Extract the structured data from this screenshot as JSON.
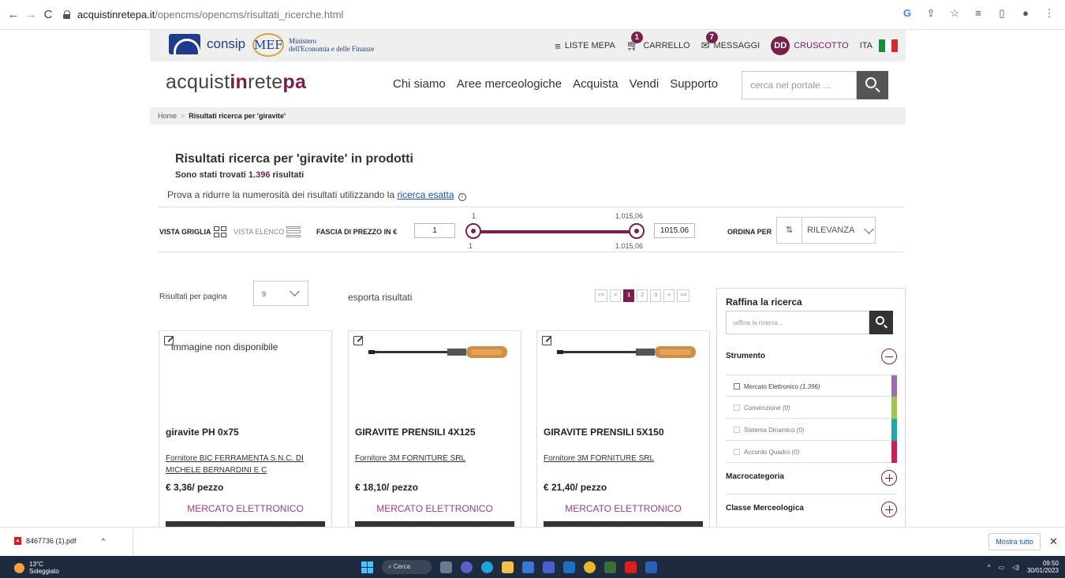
{
  "browser": {
    "url_host": "acquistinretepa.it",
    "url_path": "/opencms/opencms/risultati_ricerche.html"
  },
  "top_bar": {
    "consip_label": "consip",
    "mef_label": "MEF",
    "mef_line1": "Ministero",
    "mef_line2": "dell'Economia e delle Finanze",
    "liste_mepa": "LISTE MEPA",
    "carrello": "CARRELLO",
    "carrello_badge": "1",
    "messaggi": "MESSAGGI",
    "messaggi_badge": "7",
    "avatar": "DD",
    "cruscotto": "CRUSCOTTO",
    "lang": "ITA"
  },
  "header": {
    "brand_a": "acquist",
    "brand_b": "in",
    "brand_c": "rete",
    "brand_d": "pa",
    "nav": [
      "Chi siamo",
      "Aree merceologiche",
      "Acquista",
      "Vendi",
      "Supporto"
    ],
    "search_placeholder": "cerca nel portale ..."
  },
  "breadcrumb": {
    "home": "Home",
    "sep": ">",
    "current": "Risultati ricerca per 'giravite'"
  },
  "results": {
    "title": "Risultati ricerca per 'giravite' in prodotti",
    "count_prefix": "Sono stati trovati ",
    "count": "1.396",
    "count_suffix": " risultati",
    "tip_prefix": "Prova a ridurre la numerosità dei risultati utilizzando la ",
    "tip_link": "ricerca esatta"
  },
  "toolbar": {
    "vista_griglia": "VISTA GRIGLIA",
    "vista_elenco": "VISTA ELENCO",
    "fascia_prezzo": "FASCIA DI PREZZO IN €",
    "price_min": "1",
    "price_max": "1015.06",
    "slider_min_label": "1",
    "slider_max_label": "1.015,06",
    "ordina_per": "ORDINA PER",
    "sort_value": "RILEVANZA"
  },
  "listing": {
    "perpage_label": "Risultati per pagina",
    "perpage_value": "9",
    "export": "esporta risultati",
    "pager": [
      "<<",
      "<",
      "1",
      "2",
      "3",
      ">",
      ">>"
    ],
    "active_page": "1"
  },
  "cards": [
    {
      "img_alt": "immagine non disponibile",
      "title": "giravite PH 0x75",
      "supplier": "Fornitore BIC FERRAMENTA S.N.C. DI MICHELE BERNARDINI E C",
      "price": "€ 3,36/ pezzo",
      "market": "MERCATO ELETTRONICO"
    },
    {
      "img_alt": "",
      "title": "GIRAVITE PRENSILI 4X125",
      "supplier": "Fornitore 3M FORNITURE SRL",
      "price": "€ 18,10/ pezzo",
      "market": "MERCATO ELETTRONICO"
    },
    {
      "img_alt": "",
      "title": "GIRAVITE PRENSILI 5X150",
      "supplier": "Fornitore 3M FORNITURE SRL",
      "price": "€ 21,40/ pezzo",
      "market": "MERCATO ELETTRONICO"
    }
  ],
  "sidebar": {
    "title": "Raffina la ricerca",
    "search_placeholder": "raffina la ricerca...",
    "strumento": "Strumento",
    "options": [
      {
        "label": "Mercato Elettronico",
        "count": "(1.396)",
        "color": "#9b6fae"
      },
      {
        "label": "Convenzione",
        "count": "(0)",
        "color": "#a4c45a"
      },
      {
        "label": "Sistema Dinamico",
        "count": "(0)",
        "color": "#2aa6a0"
      },
      {
        "label": "Accordo Quadro",
        "count": "(0)",
        "color": "#c0245a"
      }
    ],
    "macrocategoria": "Macrocategoria",
    "classe": "Classe Merceologica"
  },
  "downloads": {
    "file": "8467736 (1).pdf",
    "show_all": "Mostra tutto"
  },
  "taskbar": {
    "temp": "13°C",
    "weather": "Soleggiato",
    "search": "Cerca",
    "time": "09:50",
    "date": "30/01/2023"
  },
  "colors": {
    "brand": "#7a1f4b",
    "market_text": "#9a3f8a"
  }
}
